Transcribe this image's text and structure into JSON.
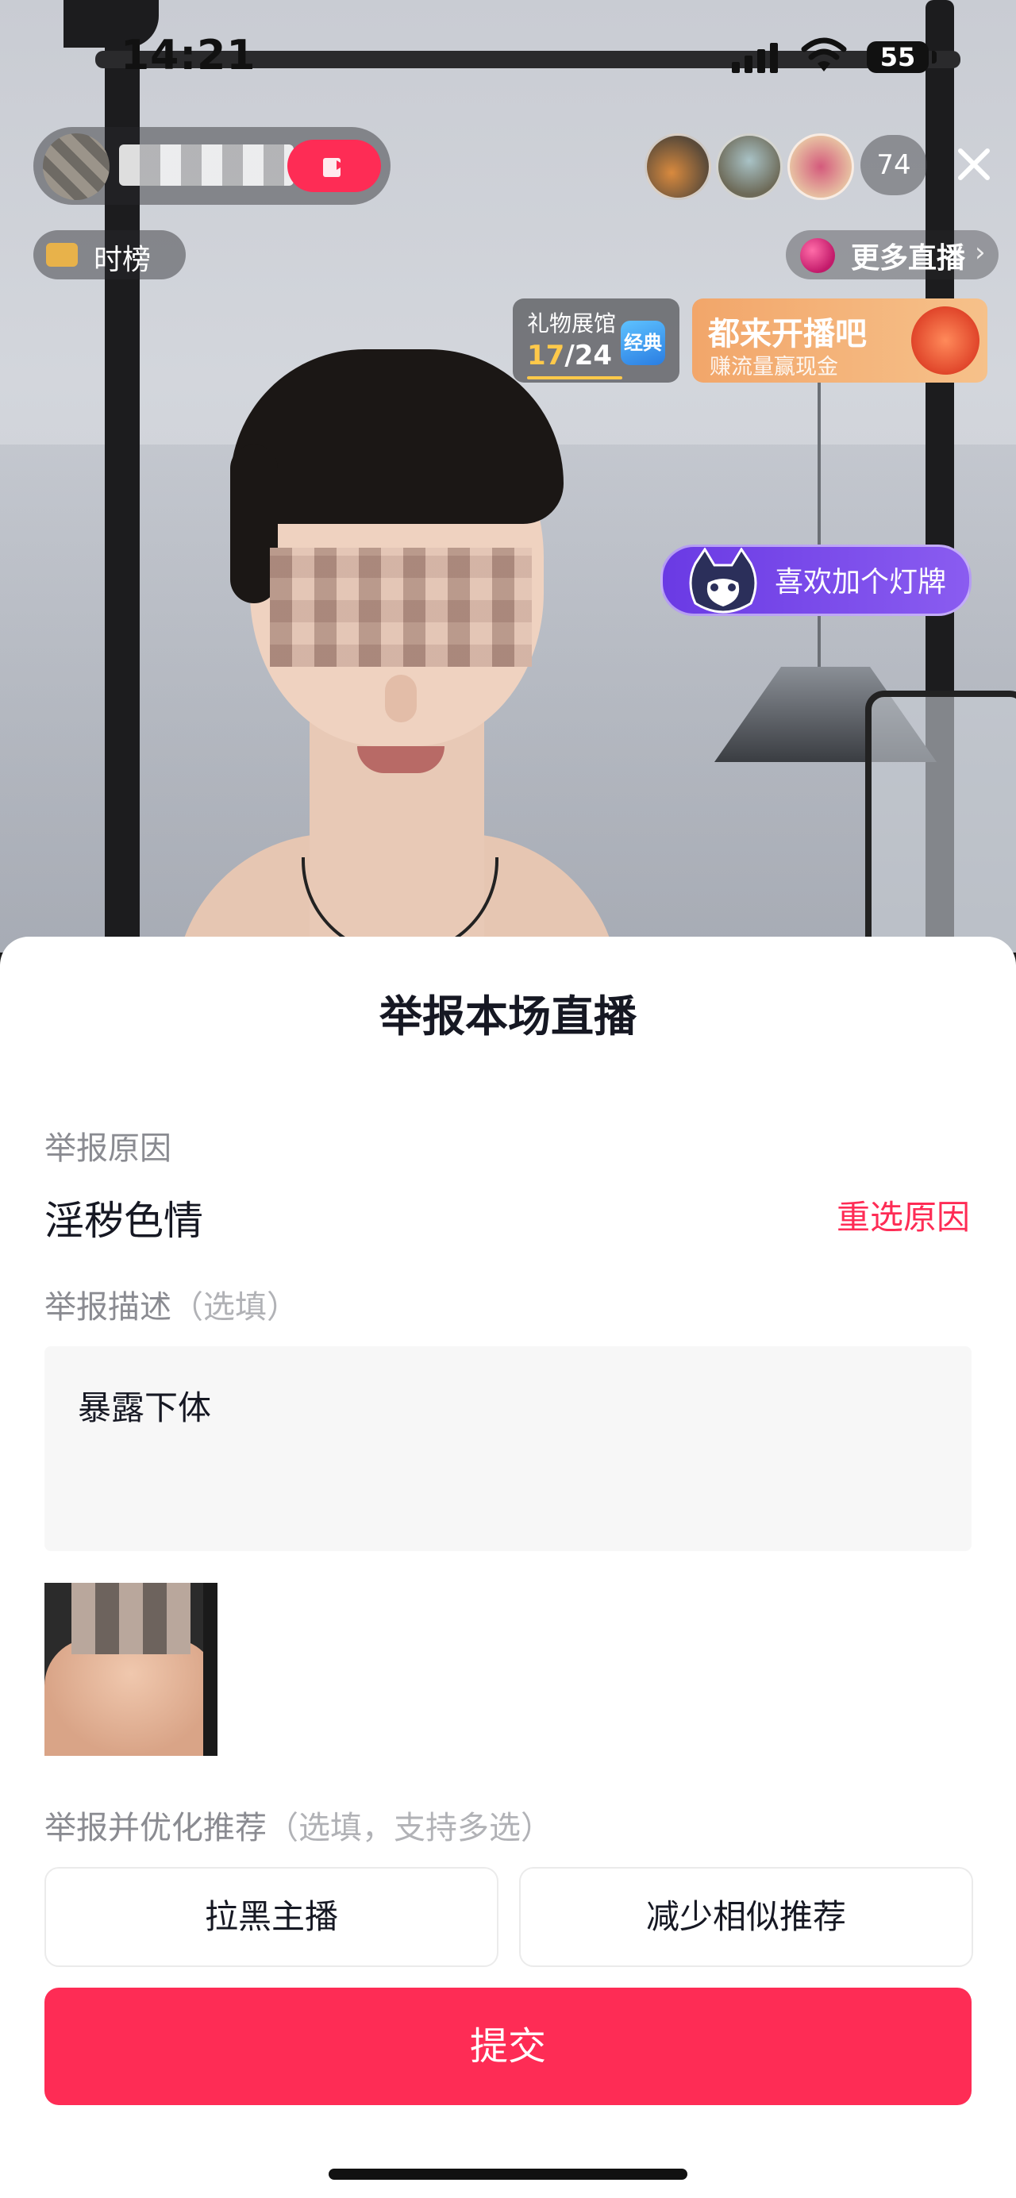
{
  "status_bar": {
    "time": "14:21",
    "battery": "55"
  },
  "live": {
    "rank_label": "时榜",
    "follow_badge": "",
    "viewer_count": "74",
    "more_live_label": "更多直播",
    "gift_hall": {
      "label": "礼物展馆",
      "progress_current": "17",
      "progress_total": "/24",
      "badge": "经典"
    },
    "promo": {
      "title": "都来开播吧",
      "subtitle": "赚流量赢现金"
    },
    "fan_club_label": "喜欢加个灯牌"
  },
  "report": {
    "title": "举报本场直播",
    "reason_label": "举报原因",
    "reason_value": "淫秽色情",
    "reselect_label": "重选原因",
    "description_label": "举报描述",
    "description_hint": "（选填）",
    "description_text": "暴露下体",
    "optimize_label": "举报并优化推荐",
    "optimize_hint": "（选填，支持多选）",
    "options": [
      "拉黑主播",
      "减少相似推荐"
    ],
    "submit_label": "提交"
  },
  "colors": {
    "accent": "#fe2c55",
    "muted_text": "#8a8b91",
    "input_bg": "#f7f7f7"
  }
}
